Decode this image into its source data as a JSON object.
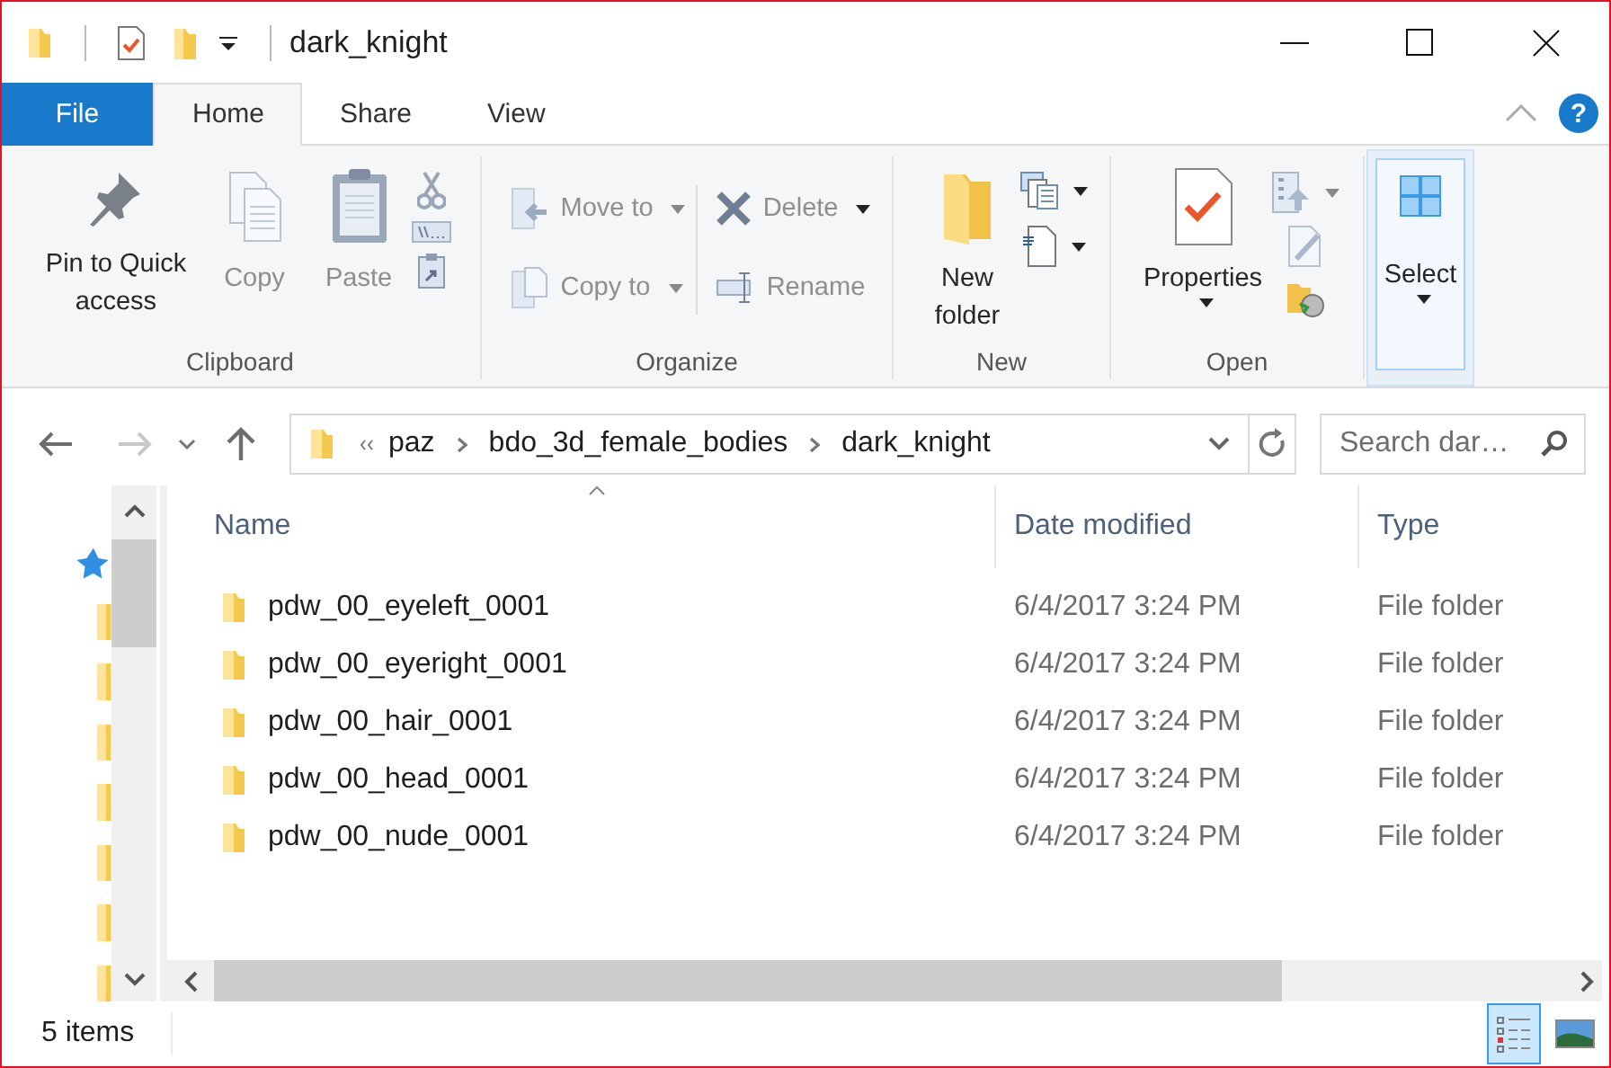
{
  "window": {
    "title": "dark_knight"
  },
  "tabs": [
    {
      "label": "File",
      "kind": "file",
      "selected": false
    },
    {
      "label": "Home",
      "kind": "tab",
      "selected": true
    },
    {
      "label": "Share",
      "kind": "tab",
      "selected": false
    },
    {
      "label": "View",
      "kind": "tab",
      "selected": false
    }
  ],
  "help": "?",
  "ribbon": {
    "groups": [
      {
        "label": "Clipboard",
        "highlighted": false,
        "commands": [
          {
            "label": "Pin to Quick access",
            "disabled": false
          },
          {
            "label": "Copy",
            "disabled": true
          },
          {
            "label": "Paste",
            "disabled": true
          }
        ]
      },
      {
        "label": "Organize",
        "highlighted": false,
        "commands": [
          {
            "label": "Move to",
            "disabled": true
          },
          {
            "label": "Copy to",
            "disabled": true
          },
          {
            "label": "Delete",
            "disabled": true
          },
          {
            "label": "Rename",
            "disabled": true
          }
        ]
      },
      {
        "label": "New",
        "highlighted": false,
        "commands": [
          {
            "label": "New folder",
            "disabled": false
          }
        ]
      },
      {
        "label": "Open",
        "highlighted": false,
        "commands": [
          {
            "label": "Properties",
            "disabled": false
          }
        ]
      },
      {
        "highlighted": true,
        "commands": [
          {
            "label": "Select",
            "disabled": false
          }
        ]
      }
    ]
  },
  "address": {
    "breadcrumbs": [
      "paz",
      "bdo_3d_female_bodies",
      "dark_knight"
    ]
  },
  "search": {
    "placeholder": "Search dar…"
  },
  "table": {
    "columns": [
      "Name",
      "Date modified",
      "Type"
    ],
    "rows": [
      {
        "name": "pdw_00_eyeleft_0001",
        "date": "6/4/2017 3:24 PM",
        "type": "File folder"
      },
      {
        "name": "pdw_00_eyeright_0001",
        "date": "6/4/2017 3:24 PM",
        "type": "File folder"
      },
      {
        "name": "pdw_00_hair_0001",
        "date": "6/4/2017 3:24 PM",
        "type": "File folder"
      },
      {
        "name": "pdw_00_head_0001",
        "date": "6/4/2017 3:24 PM",
        "type": "File folder"
      },
      {
        "name": "pdw_00_nude_0001",
        "date": "6/4/2017 3:24 PM",
        "type": "File folder"
      }
    ]
  },
  "status_bar": {
    "text": "5 items",
    "views": [
      {
        "kind": "details",
        "selected": true
      },
      {
        "kind": "large_icons",
        "selected": false
      }
    ]
  }
}
